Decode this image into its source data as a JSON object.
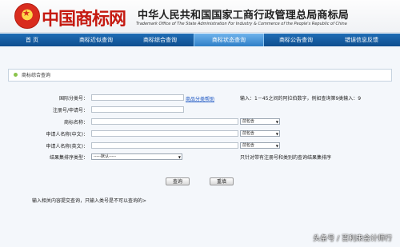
{
  "header": {
    "logo_text": "中国商标网",
    "title_cn": "中华人民共和国国家工商行政管理总局商标局",
    "title_en": "Trademark Office of The State Administration For Industry & Commerce of the People's Republic of China"
  },
  "nav": {
    "items": [
      "首 页",
      "商标近似查询",
      "商标综合查询",
      "商标状态查询",
      "商标公告查询",
      "错误信息反馈"
    ],
    "active_index": 3
  },
  "panel": {
    "title": "商标综合查询"
  },
  "form": {
    "class_label": "国际分类号：",
    "class_link": "商品分类帮助",
    "class_hint": "输入：1－45之间的阿拉伯数字，例如查询第9类输入：9",
    "regno_label": "注册号/申请号：",
    "name_label": "商标名称：",
    "name_match": "前包含",
    "applicant_cn_label": "申请人名称(中文)：",
    "applicant_cn_match": "前包含",
    "applicant_en_label": "申请人名称(英文)：",
    "applicant_en_match": "前包含",
    "sort_label": "结果集排序类型：",
    "sort_value": "-----默认-----",
    "sort_hint": "只针对带有注册号和类别的查询结果集排序"
  },
  "buttons": {
    "query": "查询",
    "reset": "重填"
  },
  "note": "输入相关内容提交查询，只输入类号是不可以查询的>",
  "watermark": "头条号 / 百利来会计师行",
  "colors": {
    "nav_bg": "#1f6db5",
    "active_tab": "#4f9ada",
    "logo_red": "#c51a11",
    "link_blue": "#1a55c2"
  }
}
